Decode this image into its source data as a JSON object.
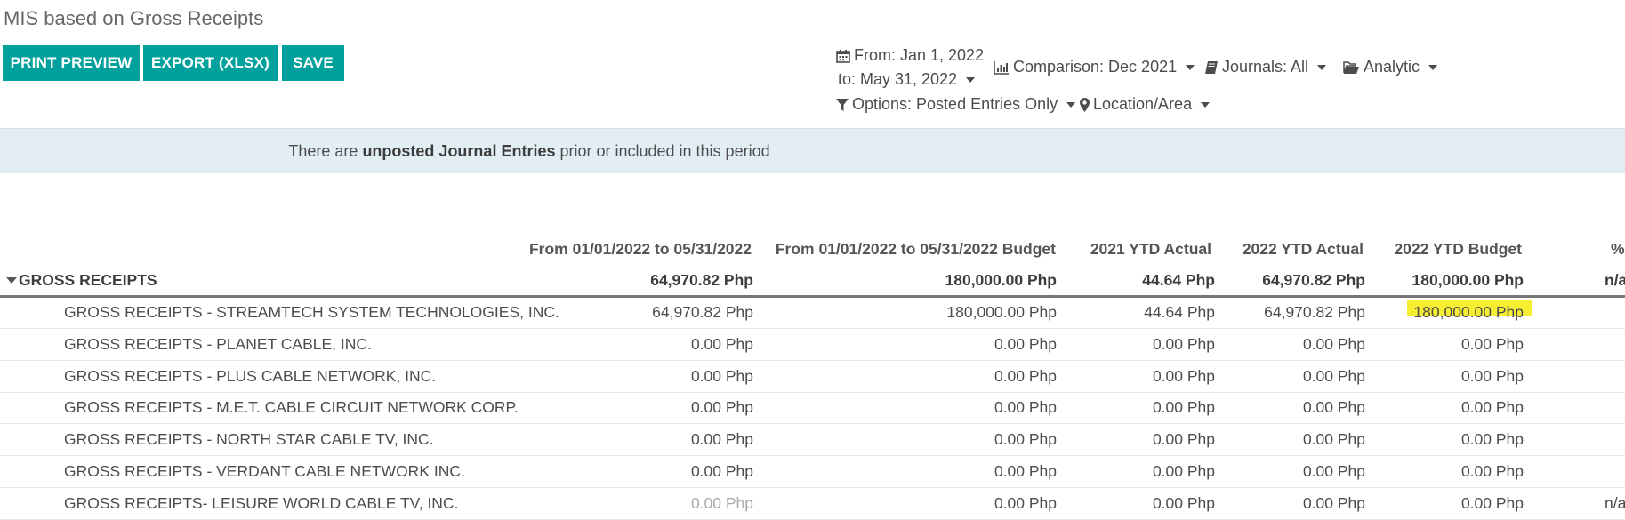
{
  "page": {
    "title": "MIS based on Gross Receipts"
  },
  "toolbar": {
    "print_label": "PRINT PREVIEW",
    "export_label": "EXPORT (XLSX)",
    "save_label": "SAVE"
  },
  "filters": {
    "date_from": "From: Jan 1, 2022",
    "date_to": "to: May 31, 2022",
    "comparison": "Comparison: Dec 2021",
    "journals": "Journals: All",
    "analytic": "Analytic",
    "options": "Options: Posted Entries Only",
    "location": "Location/Area"
  },
  "banner": {
    "prefix": "There are ",
    "bold": "unposted Journal Entries",
    "suffix": " prior or included in this period"
  },
  "colors": {
    "accent": "#00A09D",
    "banner_bg": "#e2eef4",
    "highlight": "#f7ee31"
  },
  "table": {
    "headers": [
      "From 01/01/2022 to 05/31/2022",
      "From 01/01/2022 to 05/31/2022 Budget",
      "2021 YTD Actual",
      "2022 YTD Actual",
      "2022 YTD Budget",
      "%"
    ],
    "total": {
      "label": "GROSS RECEIPTS",
      "values": [
        "64,970.82 Php",
        "180,000.00 Php",
        "44.64 Php",
        "64,970.82 Php",
        "180,000.00 Php",
        "n/a"
      ]
    },
    "rows": [
      {
        "label": "GROSS RECEIPTS - STREAMTECH SYSTEM TECHNOLOGIES, INC.",
        "values": [
          "64,970.82 Php",
          "180,000.00 Php",
          "44.64 Php",
          "64,970.82 Php",
          "180,000.00 Php",
          ""
        ]
      },
      {
        "label": "GROSS RECEIPTS - PLANET CABLE, INC.",
        "values": [
          "0.00 Php",
          "0.00 Php",
          "0.00 Php",
          "0.00 Php",
          "0.00 Php",
          ""
        ]
      },
      {
        "label": "GROSS RECEIPTS - PLUS CABLE NETWORK, INC.",
        "values": [
          "0.00 Php",
          "0.00 Php",
          "0.00 Php",
          "0.00 Php",
          "0.00 Php",
          ""
        ]
      },
      {
        "label": "GROSS RECEIPTS - M.E.T. CABLE CIRCUIT NETWORK CORP.",
        "values": [
          "0.00 Php",
          "0.00 Php",
          "0.00 Php",
          "0.00 Php",
          "0.00 Php",
          ""
        ]
      },
      {
        "label": "GROSS RECEIPTS - NORTH STAR CABLE TV, INC.",
        "values": [
          "0.00 Php",
          "0.00 Php",
          "0.00 Php",
          "0.00 Php",
          "0.00 Php",
          ""
        ]
      },
      {
        "label": "GROSS RECEIPTS - VERDANT CABLE NETWORK INC.",
        "values": [
          "0.00 Php",
          "0.00 Php",
          "0.00 Php",
          "0.00 Php",
          "0.00 Php",
          ""
        ]
      },
      {
        "label": "GROSS RECEIPTS- LEISURE WORLD CABLE TV, INC.",
        "values": [
          "0.00 Php",
          "0.00 Php",
          "0.00 Php",
          "0.00 Php",
          "0.00 Php",
          "n/a"
        ]
      }
    ]
  }
}
